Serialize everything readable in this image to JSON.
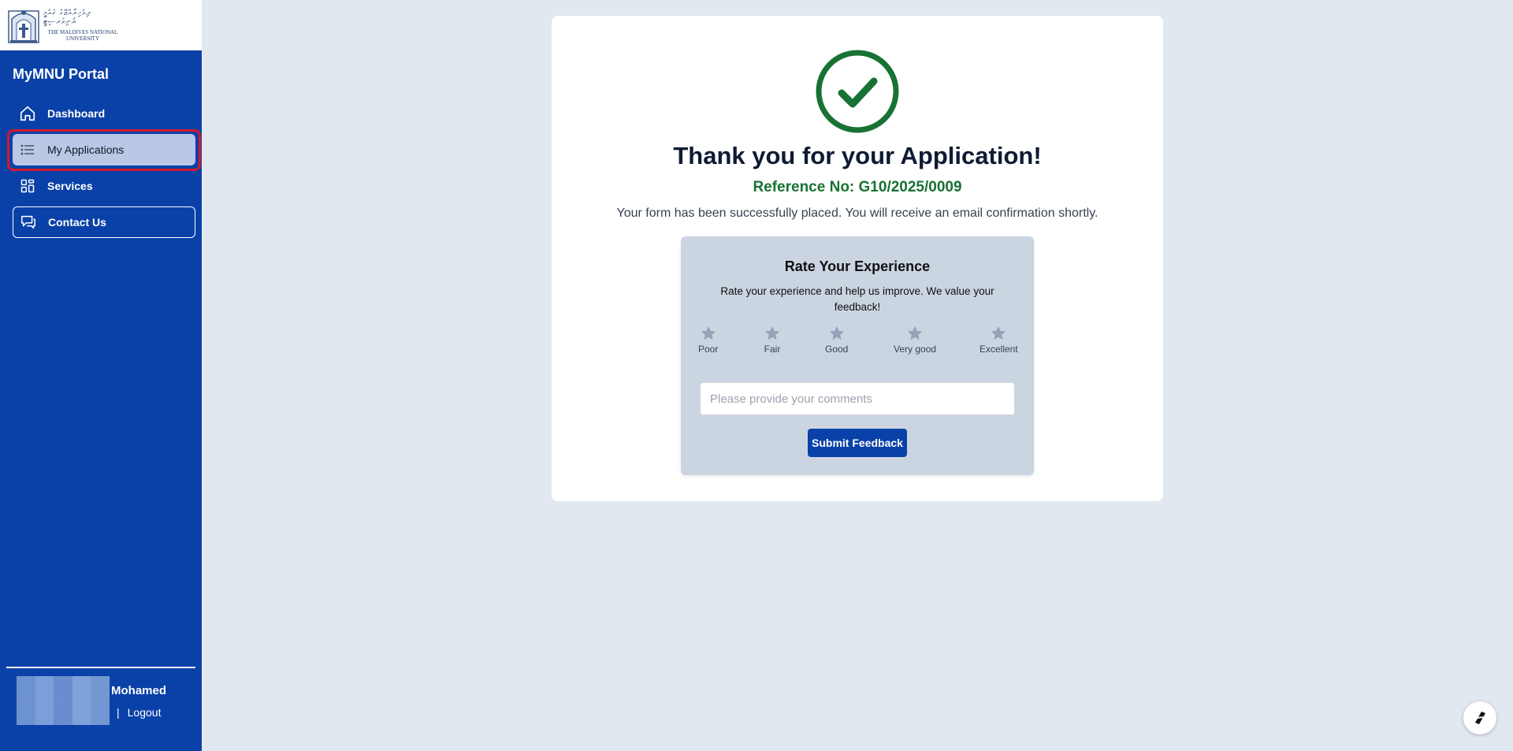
{
  "sidebar": {
    "logo": {
      "script_text": "ދިވެހިރާއްޖޭގެ ޤައުމީ ޔުނިވަރސިޓީ",
      "name_line1": "THE MALDIVES NATIONAL",
      "name_line2": "UNIVERSITY"
    },
    "portal_title": "MyMNU Portal",
    "items": [
      {
        "label": "Dashboard",
        "icon": "home-icon"
      },
      {
        "label": "My Applications",
        "icon": "list-icon",
        "active": true
      },
      {
        "label": "Services",
        "icon": "grid-icon"
      },
      {
        "label": "Contact Us",
        "icon": "chat-icon"
      }
    ],
    "user": {
      "name": "Mohamed",
      "separator": "|",
      "logout_label": "Logout"
    }
  },
  "confirmation": {
    "title": "Thank you for your Application!",
    "reference": "Reference No: G10/2025/0009",
    "message": "Your form has been successfully placed. You will receive an email confirmation shortly."
  },
  "rating": {
    "title": "Rate Your Experience",
    "subtitle": "Rate your experience and help us improve. We value your feedback!",
    "options": [
      "Poor",
      "Fair",
      "Good",
      "Very good",
      "Excellent"
    ],
    "comments_placeholder": "Please provide your comments",
    "comments_value": "",
    "submit_label": "Submit Feedback"
  },
  "colors": {
    "sidebar_bg": "#0a41a8",
    "page_bg": "#e2e8f0",
    "success_green": "#177233",
    "star_gray": "#94a3b8",
    "active_item_bg": "#b9c8e4",
    "highlight_red": "#d7182a"
  }
}
